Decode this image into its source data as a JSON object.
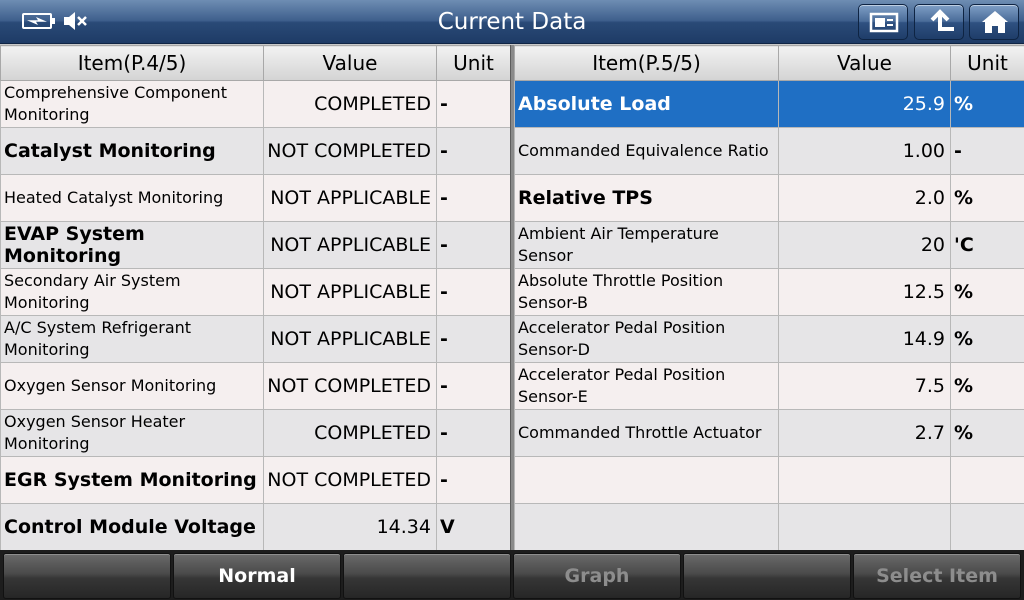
{
  "header": {
    "title": "Current Data"
  },
  "left_table": {
    "headers": [
      "Item(P.4/5)",
      "Value",
      "Unit"
    ],
    "rows": [
      {
        "item": "Comprehensive Component Monitoring",
        "value": "COMPLETED",
        "unit": "-"
      },
      {
        "item": "Catalyst Monitoring",
        "value": "NOT COMPLETED",
        "unit": "-"
      },
      {
        "item": "Heated Catalyst Monitoring",
        "value": "NOT APPLICABLE",
        "unit": "-"
      },
      {
        "item": "EVAP System Monitoring",
        "value": "NOT APPLICABLE",
        "unit": "-"
      },
      {
        "item": "Secondary Air System Monitoring",
        "value": "NOT APPLICABLE",
        "unit": "-"
      },
      {
        "item": "A/C System Refrigerant Monitoring",
        "value": "NOT APPLICABLE",
        "unit": "-"
      },
      {
        "item": "Oxygen Sensor Monitoring",
        "value": "NOT COMPLETED",
        "unit": "-"
      },
      {
        "item": "Oxygen Sensor Heater Monitoring",
        "value": "COMPLETED",
        "unit": "-"
      },
      {
        "item": "EGR System Monitoring",
        "value": "NOT COMPLETED",
        "unit": "-"
      },
      {
        "item": "Control Module Voltage",
        "value": "14.34",
        "unit": "V"
      }
    ]
  },
  "right_table": {
    "headers": [
      "Item(P.5/5)",
      "Value",
      "Unit"
    ],
    "rows": [
      {
        "item": "Absolute Load",
        "value": "25.9",
        "unit": "%"
      },
      {
        "item": "Commanded Equivalence Ratio",
        "value": "1.00",
        "unit": "-"
      },
      {
        "item": "Relative TPS",
        "value": "2.0",
        "unit": "%"
      },
      {
        "item": "Ambient Air Temperature Sensor",
        "value": "20",
        "unit": "'C"
      },
      {
        "item": "Absolute Throttle Position Sensor-B",
        "value": "12.5",
        "unit": "%"
      },
      {
        "item": "Accelerator Pedal Position Sensor-D",
        "value": "14.9",
        "unit": "%"
      },
      {
        "item": "Accelerator Pedal Position Sensor-E",
        "value": "7.5",
        "unit": "%"
      },
      {
        "item": "Commanded Throttle Actuator",
        "value": "2.7",
        "unit": "%"
      },
      {
        "item": "",
        "value": "",
        "unit": ""
      },
      {
        "item": "",
        "value": "",
        "unit": ""
      }
    ]
  },
  "footer": {
    "buttons": [
      "",
      "Normal",
      "",
      "Graph",
      "",
      "Select Item"
    ]
  },
  "colors": {
    "selected_row": "#1f6fc4",
    "title_bar": "#2a4a77"
  }
}
